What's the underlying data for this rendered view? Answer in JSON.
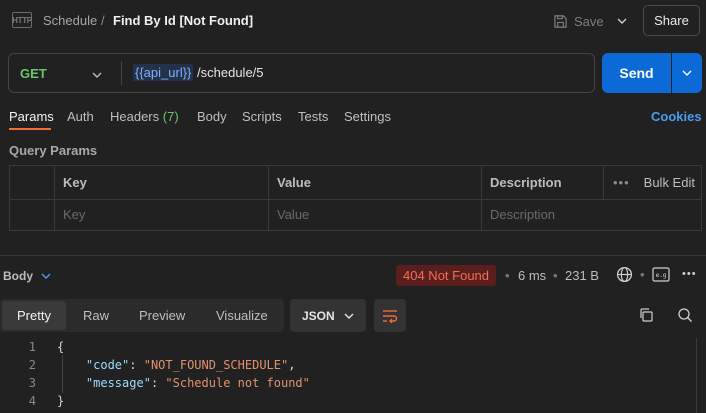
{
  "header": {
    "app_icon": "HTTP",
    "breadcrumb_parent": "Schedule",
    "breadcrumb_sep": "/",
    "title": "Find By Id [Not Found]",
    "save_label": "Save",
    "share_label": "Share"
  },
  "request": {
    "method": "GET",
    "url_variable": "{{api_url}}",
    "url_path": " /schedule/5",
    "send_label": "Send"
  },
  "tabs": [
    {
      "label": "Params",
      "active": true
    },
    {
      "label": "Auth"
    },
    {
      "label": "Headers",
      "count": "(7)"
    },
    {
      "label": "Body"
    },
    {
      "label": "Scripts"
    },
    {
      "label": "Tests"
    },
    {
      "label": "Settings"
    }
  ],
  "cookies_label": "Cookies",
  "query_params": {
    "title": "Query Params",
    "columns": [
      "Key",
      "Value",
      "Description"
    ],
    "placeholders": [
      "Key",
      "Value",
      "Description"
    ],
    "bulk_edit_label": "Bulk Edit"
  },
  "response": {
    "body_label": "Body",
    "status": "404 Not Found",
    "time": "6 ms",
    "size": "231 B",
    "views": [
      "Pretty",
      "Raw",
      "Preview",
      "Visualize"
    ],
    "active_view": "Pretty",
    "format": "JSON",
    "line_numbers": [
      "1",
      "2",
      "3",
      "4"
    ],
    "code": {
      "open": "{",
      "k1": "\"code\"",
      "v1": "\"NOT_FOUND_SCHEDULE\"",
      "k2": "\"message\"",
      "v2": "\"Schedule not found\"",
      "close": "}"
    }
  },
  "colors": {
    "accent": "#0b6ad6",
    "method_get": "#6bc56b",
    "status_error": "#f26d5e",
    "active_tab": "#f26b3a"
  }
}
